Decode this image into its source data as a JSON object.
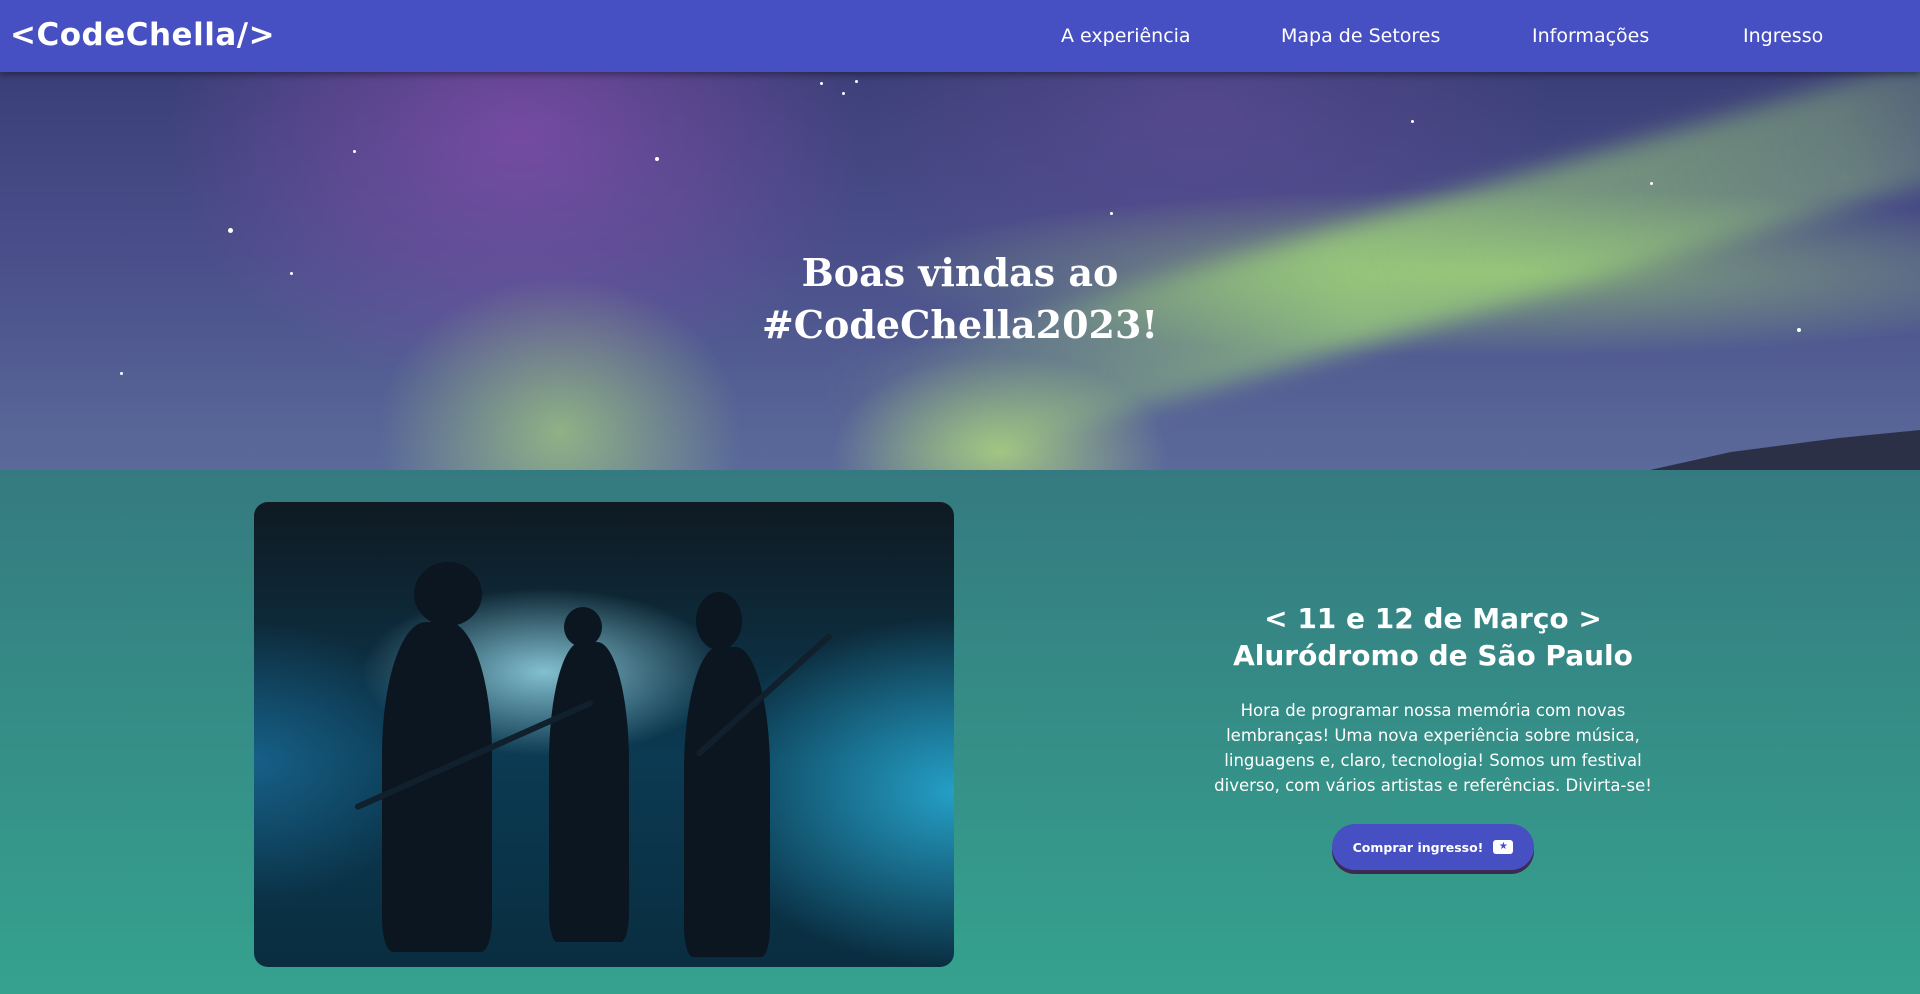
{
  "header": {
    "logo": "<CodeChella/>",
    "nav": [
      {
        "label": "A experiência"
      },
      {
        "label": "Mapa de Setores"
      },
      {
        "label": "Informações"
      },
      {
        "label": "Ingresso"
      }
    ]
  },
  "hero": {
    "title_line1": "Boas vindas ao",
    "title_line2": "#CodeChella2023!"
  },
  "event": {
    "date": "< 11 e 12 de Março >",
    "venue": "Aluródromo de São Paulo",
    "description": "Hora de programar nossa memória com novas lembranças! Uma nova experiência sobre música, linguagens e, claro, tecnologia! Somos um festival diverso, com vários artistas e referências. Divirta-se!",
    "buy_label": "Comprar ingresso!",
    "buy_icon": "ticket-icon"
  },
  "colors": {
    "header_bg": "#4750c2",
    "content_bg": "#35a28e",
    "button_bg": "#4750c2"
  }
}
